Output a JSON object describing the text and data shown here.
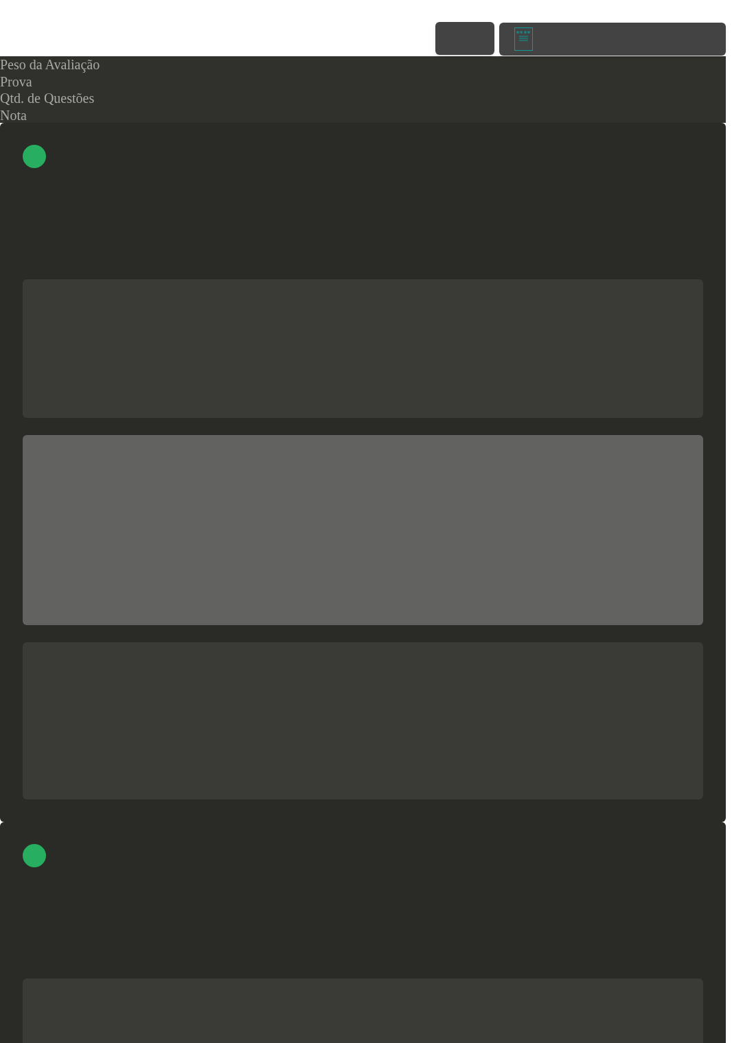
{
  "header": {
    "labels": [
      "Peso da Avaliação",
      "Prova",
      "Qtd. de Questões",
      "Nota"
    ]
  },
  "cards": [
    {
      "color": "#27ae60",
      "panels": [
        {
          "selected": false
        },
        {
          "selected": true
        },
        {
          "selected": false
        }
      ]
    },
    {
      "color": "#27ae60",
      "panels": [
        {
          "selected": false
        }
      ]
    }
  ]
}
